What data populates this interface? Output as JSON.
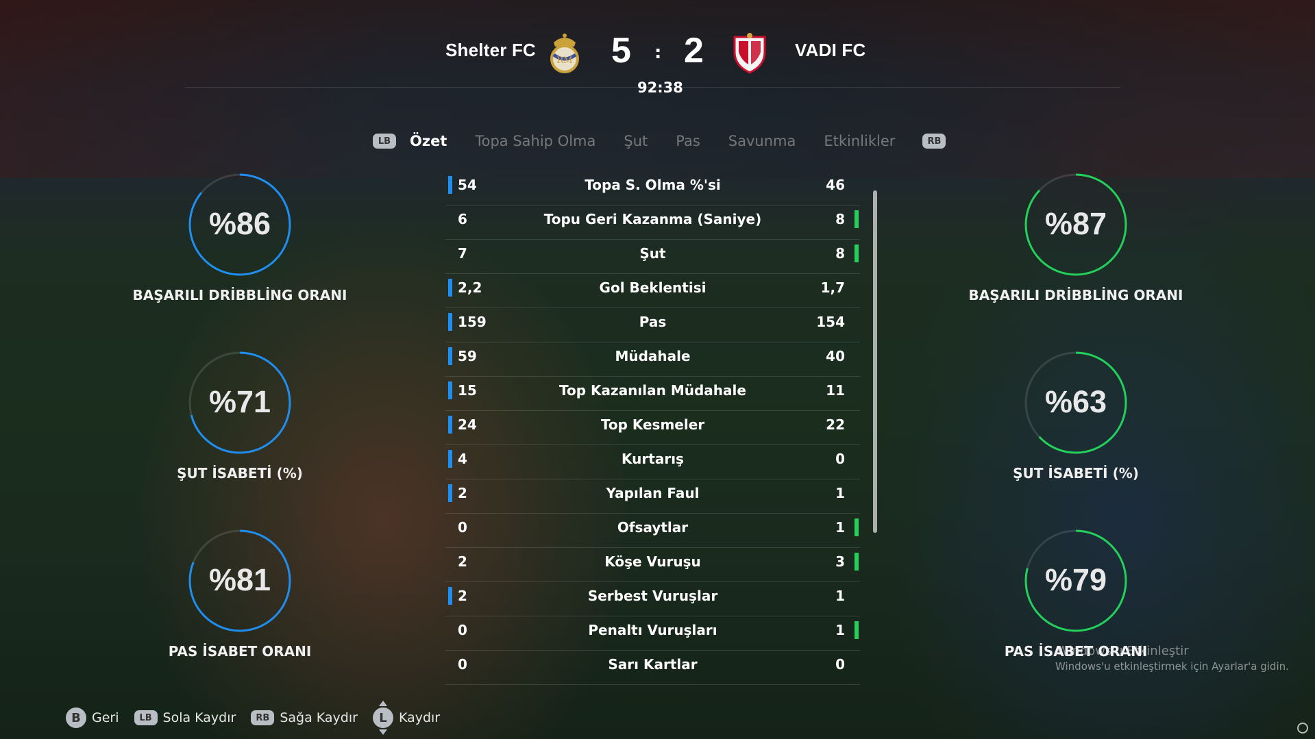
{
  "header": {
    "home_team": "Shelter FC",
    "away_team": "VADI FC",
    "home_score": "5",
    "separator": ":",
    "away_score": "2",
    "clock": "92:38"
  },
  "tabs": {
    "left_button": "LB",
    "right_button": "RB",
    "items": [
      "Özet",
      "Topa Sahip Olma",
      "Şut",
      "Pas",
      "Savunma",
      "Etkinlikler"
    ],
    "active_index": 0
  },
  "home_circles": [
    {
      "value": "%86",
      "percent": 86,
      "label": "BAŞARILI DRİBBLİNG ORANI"
    },
    {
      "value": "%71",
      "percent": 71,
      "label": "ŞUT İSABETİ (%)"
    },
    {
      "value": "%81",
      "percent": 81,
      "label": "PAS İSABET ORANI"
    }
  ],
  "away_circles": [
    {
      "value": "%87",
      "percent": 87,
      "label": "BAŞARILI DRİBBLİNG ORANI"
    },
    {
      "value": "%63",
      "percent": 63,
      "label": "ŞUT İSABETİ (%)"
    },
    {
      "value": "%79",
      "percent": 79,
      "label": "PAS İSABET ORANI"
    }
  ],
  "stats": [
    {
      "home": "54",
      "name": "Topa S. Olma %'si",
      "away": "46",
      "leader": "home"
    },
    {
      "home": "6",
      "name": "Topu Geri Kazanma (Saniye)",
      "away": "8",
      "leader": "away"
    },
    {
      "home": "7",
      "name": "Şut",
      "away": "8",
      "leader": "away"
    },
    {
      "home": "2,2",
      "name": "Gol Beklentisi",
      "away": "1,7",
      "leader": "home"
    },
    {
      "home": "159",
      "name": "Pas",
      "away": "154",
      "leader": "home"
    },
    {
      "home": "59",
      "name": "Müdahale",
      "away": "40",
      "leader": "home"
    },
    {
      "home": "15",
      "name": "Top Kazanılan Müdahale",
      "away": "11",
      "leader": "home"
    },
    {
      "home": "24",
      "name": "Top Kesmeler",
      "away": "22",
      "leader": "home"
    },
    {
      "home": "4",
      "name": "Kurtarış",
      "away": "0",
      "leader": "home"
    },
    {
      "home": "2",
      "name": "Yapılan Faul",
      "away": "1",
      "leader": "home"
    },
    {
      "home": "0",
      "name": "Ofsaytlar",
      "away": "1",
      "leader": "away"
    },
    {
      "home": "2",
      "name": "Köşe Vuruşu",
      "away": "3",
      "leader": "away"
    },
    {
      "home": "2",
      "name": "Serbest Vuruşlar",
      "away": "1",
      "leader": "home"
    },
    {
      "home": "0",
      "name": "Penaltı Vuruşları",
      "away": "1",
      "leader": "away"
    },
    {
      "home": "0",
      "name": "Sarı Kartlar",
      "away": "0",
      "leader": "none"
    }
  ],
  "footer": {
    "back_button": "B",
    "back_label": "Geri",
    "lb_button": "LB",
    "lb_label": "Sola Kaydır",
    "rb_button": "RB",
    "rb_label": "Sağa Kaydır",
    "stick_button": "L",
    "stick_label": "Kaydır"
  },
  "watermark": {
    "line1": "Windows'u Etkinleştir",
    "line2": "Windows'u etkinleştirmek için Ayarlar'a gidin."
  },
  "colors": {
    "home_accent": "#1e8ef0",
    "away_accent": "#22d05a",
    "ring_track": "rgba(255,255,255,0.12)"
  },
  "icons": {
    "home_crest": "real-madrid-style-crest-icon",
    "away_crest": "sevilla-style-crest-icon"
  }
}
